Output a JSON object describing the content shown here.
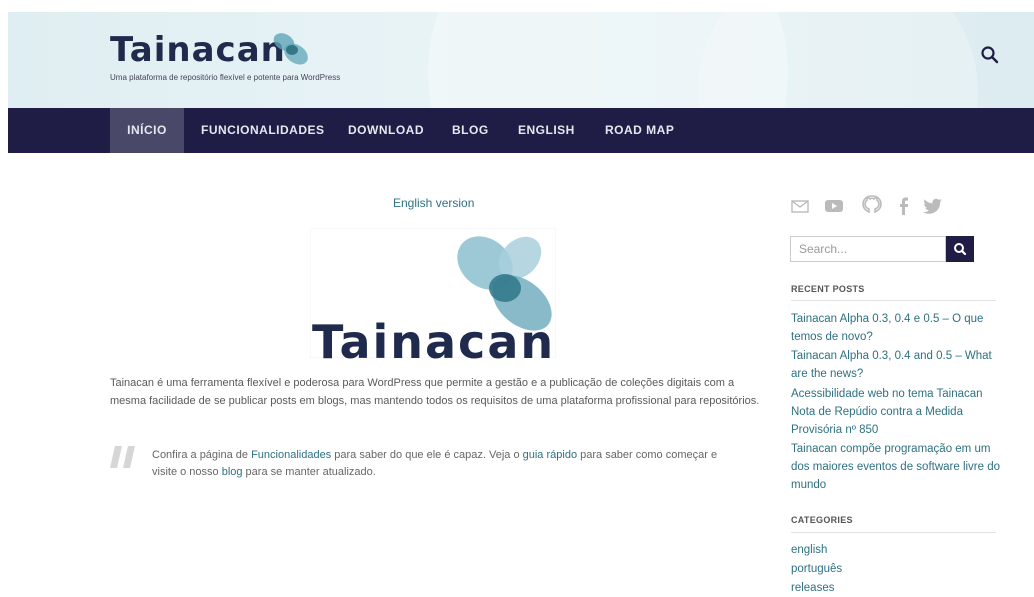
{
  "site": {
    "logo_text": "Tainacan",
    "tagline": "Uma plataforma de repositório flexível e potente para WordPress"
  },
  "nav": {
    "items": [
      {
        "label": "INÍCIO",
        "active": true
      },
      {
        "label": "FUNCIONALIDADES"
      },
      {
        "label": "DOWNLOAD"
      },
      {
        "label": "BLOG"
      },
      {
        "label": "ENGLISH"
      },
      {
        "label": "ROAD MAP"
      }
    ]
  },
  "main": {
    "english_link": "English version",
    "logo_word": "Tainacan",
    "intro": "Tainacan é uma ferramenta flexível e poderosa para WordPress que permite a gestão e a publicação de coleções digitais com a mesma facilidade de se publicar posts em blogs, mas mantendo todos os requisitos de uma plataforma profissional para repositórios.",
    "quote": {
      "part1": "Confira a página de ",
      "link1": "Funcionalidades",
      "part2": " para saber do que ele é capaz. Veja o ",
      "link2": "guia rápido",
      "part3": " para saber como começar e visite o nosso ",
      "link3": "blog",
      "part4": " para se manter atualizado."
    }
  },
  "sidebar": {
    "social_icons": [
      "email-icon",
      "youtube-icon",
      "github-icon",
      "facebook-icon",
      "twitter-icon"
    ],
    "search_placeholder": "Search...",
    "recent_posts_title": "RECENT POSTS",
    "recent_posts": [
      "Tainacan Alpha 0.3, 0.4 e 0.5 – O que temos de novo?",
      "Tainacan Alpha 0.3, 0.4 and 0.5 – What are the news?",
      "Acessibilidade web no tema Tainacan",
      "Nota de Repúdio contra a Medida Provisória nº 850",
      "Tainacan compõe programação em um dos maiores eventos de software livre do mundo"
    ],
    "categories_title": "CATEGORIES",
    "categories": [
      "english",
      "português",
      "releases"
    ]
  },
  "colors": {
    "nav_bg": "#1f1d45",
    "nav_active": "#4a4868",
    "link": "#2e7182",
    "brand_dark": "#1f2a4d",
    "brand_teal": "#5fa6b8"
  }
}
